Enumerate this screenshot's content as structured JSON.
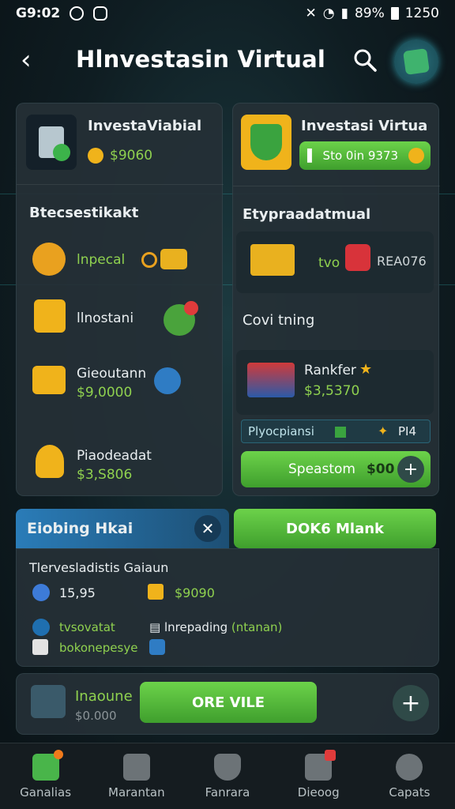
{
  "status": {
    "time": "G9:02",
    "battery": "89%",
    "clock": "1250"
  },
  "header": {
    "title": "Hlnvestasin Virtual"
  },
  "card_left": {
    "title": "InvestaViabial",
    "amount": "$9060",
    "section": "Btecsestikakt",
    "rows": [
      {
        "label": "lnpecal",
        "amount": ""
      },
      {
        "label": "llnostani",
        "amount": ""
      },
      {
        "label": "Gieoutann",
        "amount": "$9,0000"
      },
      {
        "label": "Piaodeadat",
        "amount": "$3,S806"
      }
    ]
  },
  "card_right": {
    "title": "Investasi Virtua",
    "pill": "Sto 0in 9373",
    "section": "Etypraadatmual",
    "row_mid": "tvo",
    "row_code": "REA076",
    "section2": "Covi tning",
    "ranker_title": "Rankfer",
    "ranker_amount": "$3,5370",
    "bar_label": "Plyocpiansi",
    "bar_badge": "PI4",
    "cta_label": "Speastom",
    "cta_amount": "$00"
  },
  "banner": {
    "title": "Eiobing Hkai",
    "button": "DOK6 Mlank"
  },
  "details": {
    "heading": "Tlervesladistis Gaiaun",
    "stat1": "15,95",
    "stat2": "$9090",
    "item1": "tvsovatat",
    "item2": "lnrepading",
    "item2_suffix": "(ntanan)",
    "item3": "bokonepesye"
  },
  "bottom_card": {
    "title": "Inaoune",
    "amount": "$0.000",
    "button": "ORE VILE"
  },
  "nav": {
    "items": [
      "Ganalias",
      "Marantan",
      "Fanrara",
      "Dieoog",
      "Capats"
    ]
  },
  "colors": {
    "accent_green": "#5ec23f",
    "banner_blue": "#1f5f88",
    "money_green": "#8fd14f"
  }
}
